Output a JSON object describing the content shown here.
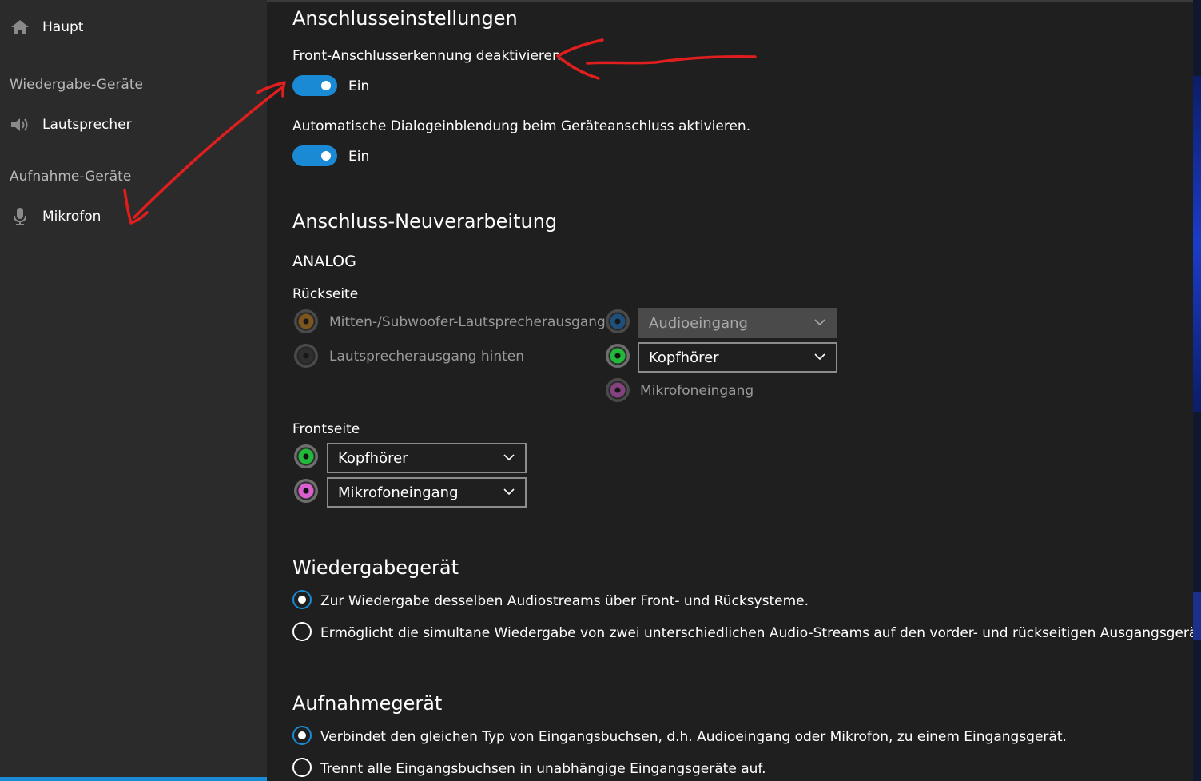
{
  "sidebar": {
    "home": {
      "label": "Haupt",
      "icon": "home-icon"
    },
    "playback_header": "Wiedergabe-Geräte",
    "speaker": {
      "label": "Lautsprecher",
      "icon": "speaker-icon"
    },
    "recording_header": "Aufnahme-Geräte",
    "microphone": {
      "label": "Mikrofon",
      "icon": "microphone-icon"
    }
  },
  "connector_settings": {
    "title": "Anschlusseinstellungen",
    "front_detect": {
      "label": "Front-Anschlusserkennung deaktivieren",
      "state": "Ein"
    },
    "auto_popup": {
      "label": "Automatische Dialogeinblendung beim Geräteanschluss aktivieren.",
      "state": "Ein"
    }
  },
  "retasking": {
    "title": "Anschluss-Neuverarbeitung",
    "analog": "ANALOG",
    "rear": {
      "label": "Rückseite",
      "center_sub": "Mitten-/Subwoofer-Lautsprecherausgang",
      "rear_speaker": "Lautsprecherausgang hinten",
      "audio_in_select": "Audioeingang",
      "headphone_select": "Kopfhörer",
      "mic_in": "Mikrofoneingang"
    },
    "front": {
      "label": "Frontseite",
      "headphone_select": "Kopfhörer",
      "mic_select": "Mikrofoneingang"
    }
  },
  "playback_device": {
    "title": "Wiedergabegerät",
    "option1": "Zur Wiedergabe desselben Audiostreams über Front- und Rücksysteme.",
    "option2": "Ermöglicht die simultane Wiedergabe von zwei unterschiedlichen Audio-Streams auf den vorder- und rückseitigen Ausgangsgeräten"
  },
  "recording_device": {
    "title": "Aufnahmegerät",
    "option1": "Verbindet den gleichen Typ von Eingangsbuchsen, d.h. Audioeingang oder Mikrofon, zu einem Eingangsgerät.",
    "option2": "Trennt alle Eingangsbuchsen in unabhängige Eingangsgeräte auf."
  },
  "colors": {
    "accent": "#1a8ad4",
    "jack_orange": "#c9821c",
    "jack_black": "#3c3c3c",
    "jack_blue": "#1f78c8",
    "jack_green": "#22b83a",
    "jack_pink": "#d95fd0",
    "annotation_red": "#e01e1e"
  }
}
